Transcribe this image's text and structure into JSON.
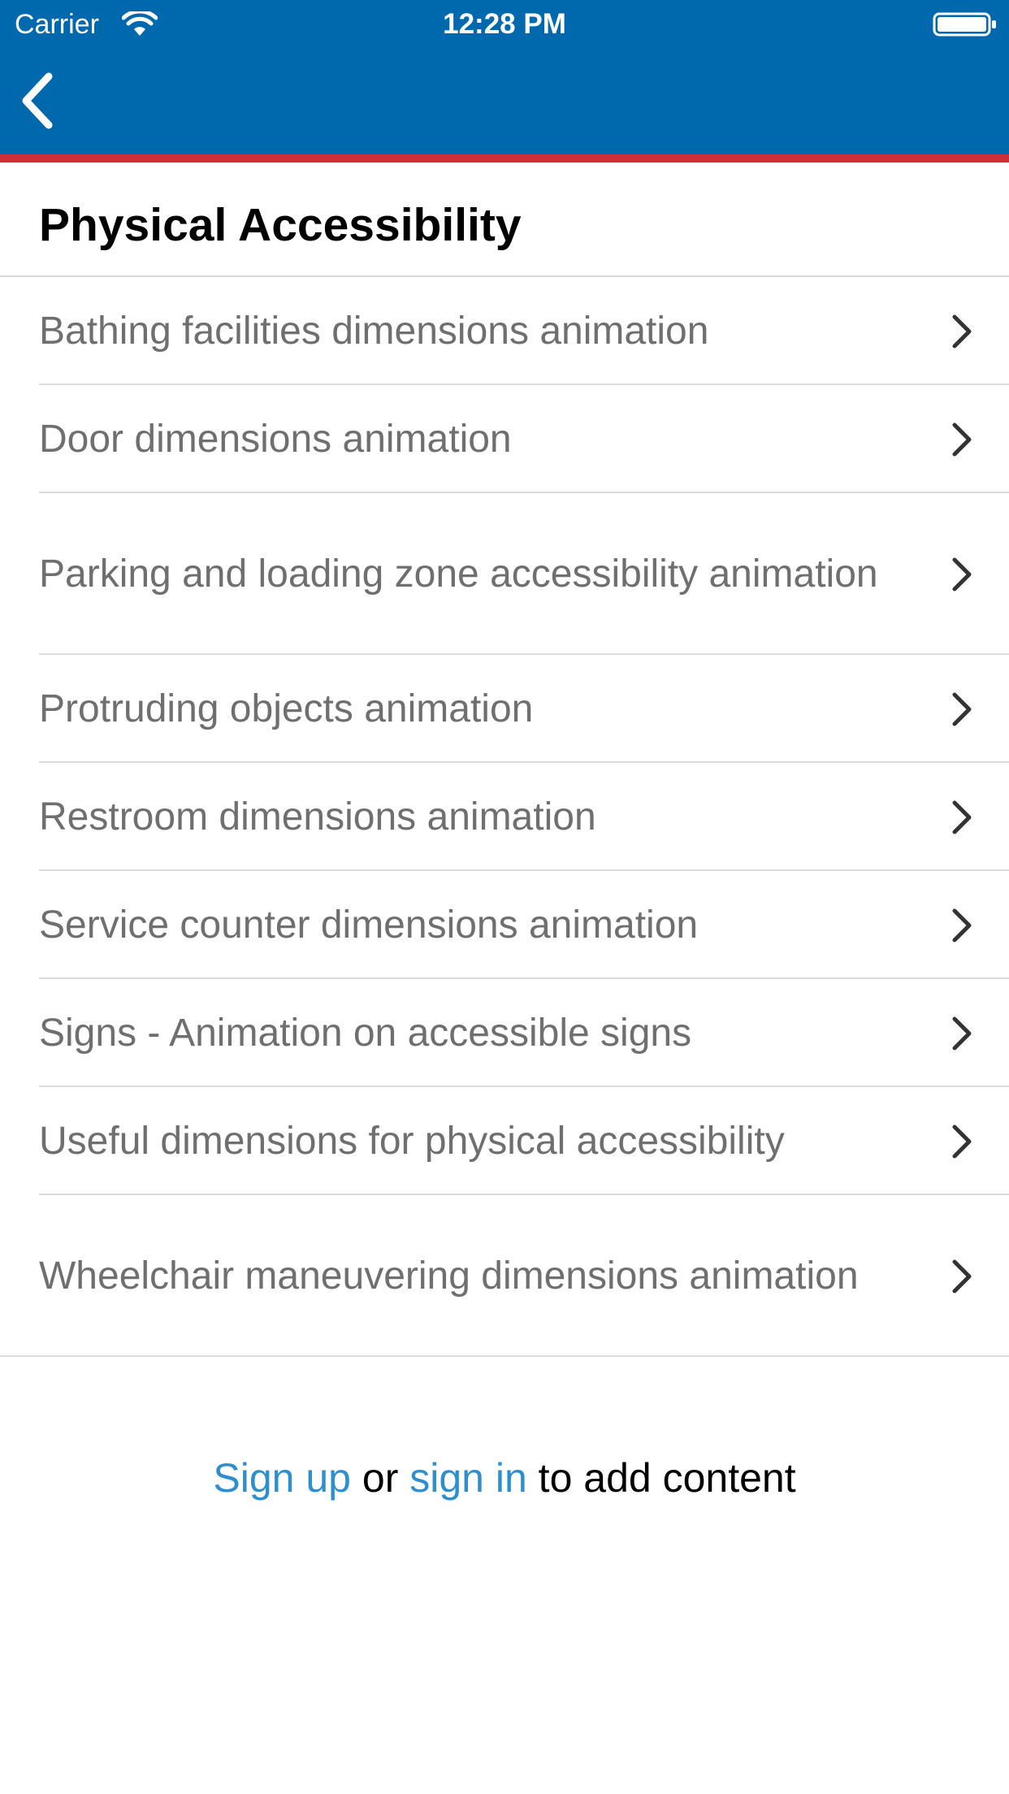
{
  "status_bar": {
    "carrier": "Carrier",
    "time": "12:28 PM"
  },
  "nav": {
    "back_icon": "chevron-left-icon",
    "bar_color": "#0069ad",
    "accent_color": "#d02e37"
  },
  "page": {
    "title": "Physical Accessibility"
  },
  "list": {
    "items": [
      {
        "label": "Bathing facilities dimensions animation"
      },
      {
        "label": "Door dimensions animation"
      },
      {
        "label": "Parking and loading zone accessibility animation"
      },
      {
        "label": "Protruding objects animation"
      },
      {
        "label": "Restroom dimensions animation"
      },
      {
        "label": "Service counter dimensions animation"
      },
      {
        "label": "Signs - Animation on accessible signs"
      },
      {
        "label": "Useful dimensions for physical accessibility"
      },
      {
        "label": "Wheelchair maneuvering dimensions animation"
      }
    ],
    "chevron_icon": "chevron-right-icon"
  },
  "footer": {
    "sign_up": "Sign up",
    "or": " or ",
    "sign_in": "sign in",
    "suffix": " to add content",
    "link_color": "#2e8fcf"
  }
}
